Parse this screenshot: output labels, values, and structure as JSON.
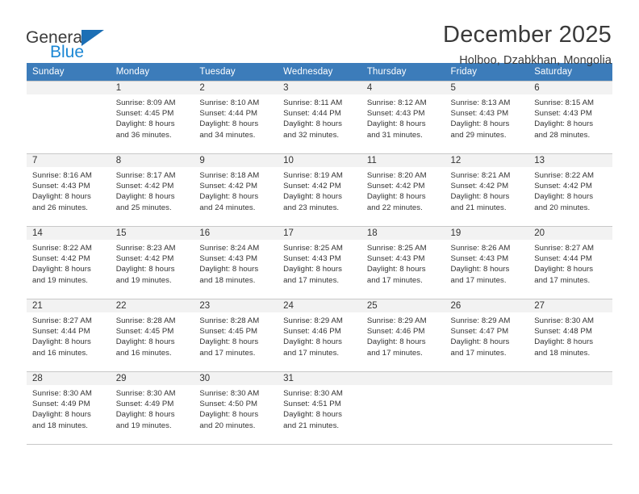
{
  "brand": {
    "name_part1": "General",
    "name_part2": "Blue",
    "logo_icon": "triangle-logo-icon",
    "accent_color": "#1b87d4",
    "triangle_color": "#1c6fb5"
  },
  "header": {
    "title": "December 2025",
    "subtitle": "Holboo, Dzabkhan, Mongolia"
  },
  "calendar": {
    "header_bg_color": "#3c7cba",
    "daynum_bg_color": "#f2f2f2",
    "weekday_headers": [
      "Sunday",
      "Monday",
      "Tuesday",
      "Wednesday",
      "Thursday",
      "Friday",
      "Saturday"
    ],
    "weeks": [
      [
        {
          "day": "",
          "lines": []
        },
        {
          "day": "1",
          "lines": [
            "Sunrise: 8:09 AM",
            "Sunset: 4:45 PM",
            "Daylight: 8 hours",
            "and 36 minutes."
          ]
        },
        {
          "day": "2",
          "lines": [
            "Sunrise: 8:10 AM",
            "Sunset: 4:44 PM",
            "Daylight: 8 hours",
            "and 34 minutes."
          ]
        },
        {
          "day": "3",
          "lines": [
            "Sunrise: 8:11 AM",
            "Sunset: 4:44 PM",
            "Daylight: 8 hours",
            "and 32 minutes."
          ]
        },
        {
          "day": "4",
          "lines": [
            "Sunrise: 8:12 AM",
            "Sunset: 4:43 PM",
            "Daylight: 8 hours",
            "and 31 minutes."
          ]
        },
        {
          "day": "5",
          "lines": [
            "Sunrise: 8:13 AM",
            "Sunset: 4:43 PM",
            "Daylight: 8 hours",
            "and 29 minutes."
          ]
        },
        {
          "day": "6",
          "lines": [
            "Sunrise: 8:15 AM",
            "Sunset: 4:43 PM",
            "Daylight: 8 hours",
            "and 28 minutes."
          ]
        }
      ],
      [
        {
          "day": "7",
          "lines": [
            "Sunrise: 8:16 AM",
            "Sunset: 4:43 PM",
            "Daylight: 8 hours",
            "and 26 minutes."
          ]
        },
        {
          "day": "8",
          "lines": [
            "Sunrise: 8:17 AM",
            "Sunset: 4:42 PM",
            "Daylight: 8 hours",
            "and 25 minutes."
          ]
        },
        {
          "day": "9",
          "lines": [
            "Sunrise: 8:18 AM",
            "Sunset: 4:42 PM",
            "Daylight: 8 hours",
            "and 24 minutes."
          ]
        },
        {
          "day": "10",
          "lines": [
            "Sunrise: 8:19 AM",
            "Sunset: 4:42 PM",
            "Daylight: 8 hours",
            "and 23 minutes."
          ]
        },
        {
          "day": "11",
          "lines": [
            "Sunrise: 8:20 AM",
            "Sunset: 4:42 PM",
            "Daylight: 8 hours",
            "and 22 minutes."
          ]
        },
        {
          "day": "12",
          "lines": [
            "Sunrise: 8:21 AM",
            "Sunset: 4:42 PM",
            "Daylight: 8 hours",
            "and 21 minutes."
          ]
        },
        {
          "day": "13",
          "lines": [
            "Sunrise: 8:22 AM",
            "Sunset: 4:42 PM",
            "Daylight: 8 hours",
            "and 20 minutes."
          ]
        }
      ],
      [
        {
          "day": "14",
          "lines": [
            "Sunrise: 8:22 AM",
            "Sunset: 4:42 PM",
            "Daylight: 8 hours",
            "and 19 minutes."
          ]
        },
        {
          "day": "15",
          "lines": [
            "Sunrise: 8:23 AM",
            "Sunset: 4:42 PM",
            "Daylight: 8 hours",
            "and 19 minutes."
          ]
        },
        {
          "day": "16",
          "lines": [
            "Sunrise: 8:24 AM",
            "Sunset: 4:43 PM",
            "Daylight: 8 hours",
            "and 18 minutes."
          ]
        },
        {
          "day": "17",
          "lines": [
            "Sunrise: 8:25 AM",
            "Sunset: 4:43 PM",
            "Daylight: 8 hours",
            "and 17 minutes."
          ]
        },
        {
          "day": "18",
          "lines": [
            "Sunrise: 8:25 AM",
            "Sunset: 4:43 PM",
            "Daylight: 8 hours",
            "and 17 minutes."
          ]
        },
        {
          "day": "19",
          "lines": [
            "Sunrise: 8:26 AM",
            "Sunset: 4:43 PM",
            "Daylight: 8 hours",
            "and 17 minutes."
          ]
        },
        {
          "day": "20",
          "lines": [
            "Sunrise: 8:27 AM",
            "Sunset: 4:44 PM",
            "Daylight: 8 hours",
            "and 17 minutes."
          ]
        }
      ],
      [
        {
          "day": "21",
          "lines": [
            "Sunrise: 8:27 AM",
            "Sunset: 4:44 PM",
            "Daylight: 8 hours",
            "and 16 minutes."
          ]
        },
        {
          "day": "22",
          "lines": [
            "Sunrise: 8:28 AM",
            "Sunset: 4:45 PM",
            "Daylight: 8 hours",
            "and 16 minutes."
          ]
        },
        {
          "day": "23",
          "lines": [
            "Sunrise: 8:28 AM",
            "Sunset: 4:45 PM",
            "Daylight: 8 hours",
            "and 17 minutes."
          ]
        },
        {
          "day": "24",
          "lines": [
            "Sunrise: 8:29 AM",
            "Sunset: 4:46 PM",
            "Daylight: 8 hours",
            "and 17 minutes."
          ]
        },
        {
          "day": "25",
          "lines": [
            "Sunrise: 8:29 AM",
            "Sunset: 4:46 PM",
            "Daylight: 8 hours",
            "and 17 minutes."
          ]
        },
        {
          "day": "26",
          "lines": [
            "Sunrise: 8:29 AM",
            "Sunset: 4:47 PM",
            "Daylight: 8 hours",
            "and 17 minutes."
          ]
        },
        {
          "day": "27",
          "lines": [
            "Sunrise: 8:30 AM",
            "Sunset: 4:48 PM",
            "Daylight: 8 hours",
            "and 18 minutes."
          ]
        }
      ],
      [
        {
          "day": "28",
          "lines": [
            "Sunrise: 8:30 AM",
            "Sunset: 4:49 PM",
            "Daylight: 8 hours",
            "and 18 minutes."
          ]
        },
        {
          "day": "29",
          "lines": [
            "Sunrise: 8:30 AM",
            "Sunset: 4:49 PM",
            "Daylight: 8 hours",
            "and 19 minutes."
          ]
        },
        {
          "day": "30",
          "lines": [
            "Sunrise: 8:30 AM",
            "Sunset: 4:50 PM",
            "Daylight: 8 hours",
            "and 20 minutes."
          ]
        },
        {
          "day": "31",
          "lines": [
            "Sunrise: 8:30 AM",
            "Sunset: 4:51 PM",
            "Daylight: 8 hours",
            "and 21 minutes."
          ]
        },
        {
          "day": "",
          "lines": []
        },
        {
          "day": "",
          "lines": []
        },
        {
          "day": "",
          "lines": []
        }
      ]
    ]
  }
}
